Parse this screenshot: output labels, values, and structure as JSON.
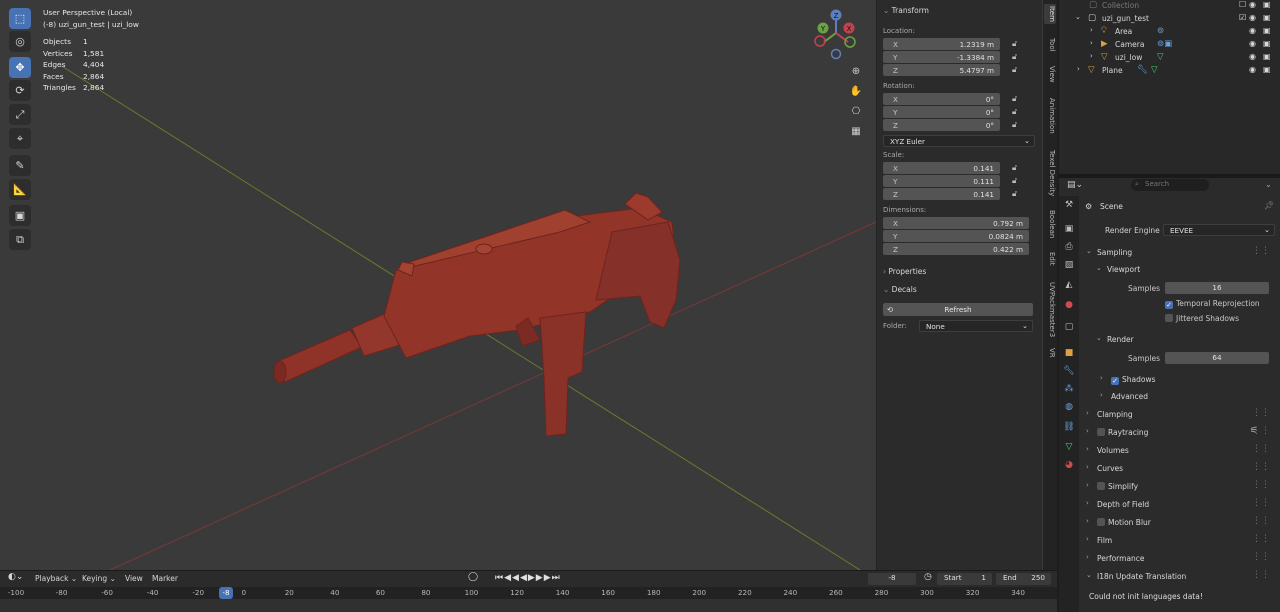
{
  "viewport": {
    "perspective": "User Perspective (Local)",
    "object_line": "(-8) uzi_gun_test | uzi_low",
    "stats": [
      {
        "key": "Objects",
        "value": "1"
      },
      {
        "key": "Vertices",
        "value": "1,581"
      },
      {
        "key": "Edges",
        "value": "4,404"
      },
      {
        "key": "Faces",
        "value": "2,864"
      },
      {
        "key": "Triangles",
        "value": "2,864"
      }
    ],
    "gizmo": {
      "z": "Z",
      "y": "Y",
      "x": "X"
    },
    "colors": {
      "model": "#8b3229",
      "background": "#3a3a3a",
      "x_axis": "#8a3a3a",
      "y_axis": "#7a8a2a"
    }
  },
  "npanel": {
    "transform_title": "Transform",
    "location_label": "Location:",
    "location": [
      {
        "axis": "X",
        "value": "1.2319 m"
      },
      {
        "axis": "Y",
        "value": "-1.3384 m"
      },
      {
        "axis": "Z",
        "value": "5.4797 m"
      }
    ],
    "rotation_label": "Rotation:",
    "rotation": [
      {
        "axis": "X",
        "value": "0°"
      },
      {
        "axis": "Y",
        "value": "0°"
      },
      {
        "axis": "Z",
        "value": "0°"
      }
    ],
    "rotation_mode": "XYZ Euler",
    "scale_label": "Scale:",
    "scale": [
      {
        "axis": "X",
        "value": "0.141"
      },
      {
        "axis": "Y",
        "value": "0.111"
      },
      {
        "axis": "Z",
        "value": "0.141"
      }
    ],
    "dimensions_label": "Dimensions:",
    "dimensions": [
      {
        "axis": "X",
        "value": "0.792 m"
      },
      {
        "axis": "Y",
        "value": "0.0824 m"
      },
      {
        "axis": "Z",
        "value": "0.422 m"
      }
    ],
    "properties_title": "Properties",
    "decals_title": "Decals",
    "refresh_label": "Refresh",
    "folder_label": "Folder:",
    "folder_value": "None",
    "tabs": [
      "Item",
      "Tool",
      "View",
      "Animation",
      "Texel Density",
      "Boolean",
      "Edit",
      "UVPackmaster3",
      "VR"
    ]
  },
  "outliner": {
    "collection": "Collection",
    "items": [
      {
        "name": "uzi_gun_test"
      },
      {
        "name": "Area"
      },
      {
        "name": "Camera"
      },
      {
        "name": "uzi_low"
      },
      {
        "name": "Plane"
      }
    ]
  },
  "properties": {
    "search_placeholder": "Search",
    "scene": "Scene",
    "render_engine_label": "Render Engine",
    "render_engine": "EEVEE",
    "sampling": "Sampling",
    "viewport": "Viewport",
    "samples_label": "Samples",
    "viewport_samples": "16",
    "temporal_reprojection": "Temporal Reprojection",
    "jittered_shadows": "Jittered Shadows",
    "render": "Render",
    "render_samples": "64",
    "shadows": "Shadows",
    "advanced": "Advanced",
    "sections": [
      "Clamping",
      "Raytracing",
      "Volumes",
      "Curves",
      "Simplify",
      "Depth of Field",
      "Motion Blur",
      "Film",
      "Performance",
      "I18n Update Translation"
    ],
    "error": "Could not init languages data!"
  },
  "timeline": {
    "menu": [
      "Playback",
      "Keying",
      "View",
      "Marker"
    ],
    "current_frame": "-8",
    "start_label": "Start",
    "start": "1",
    "end_label": "End",
    "end": "250",
    "ticks": [
      "-100",
      "-80",
      "-60",
      "-40",
      "-20",
      "0",
      "20",
      "40",
      "60",
      "80",
      "100",
      "120",
      "140",
      "160",
      "180",
      "200",
      "220",
      "240",
      "260",
      "280",
      "300",
      "320",
      "340"
    ],
    "playhead": "-8"
  }
}
